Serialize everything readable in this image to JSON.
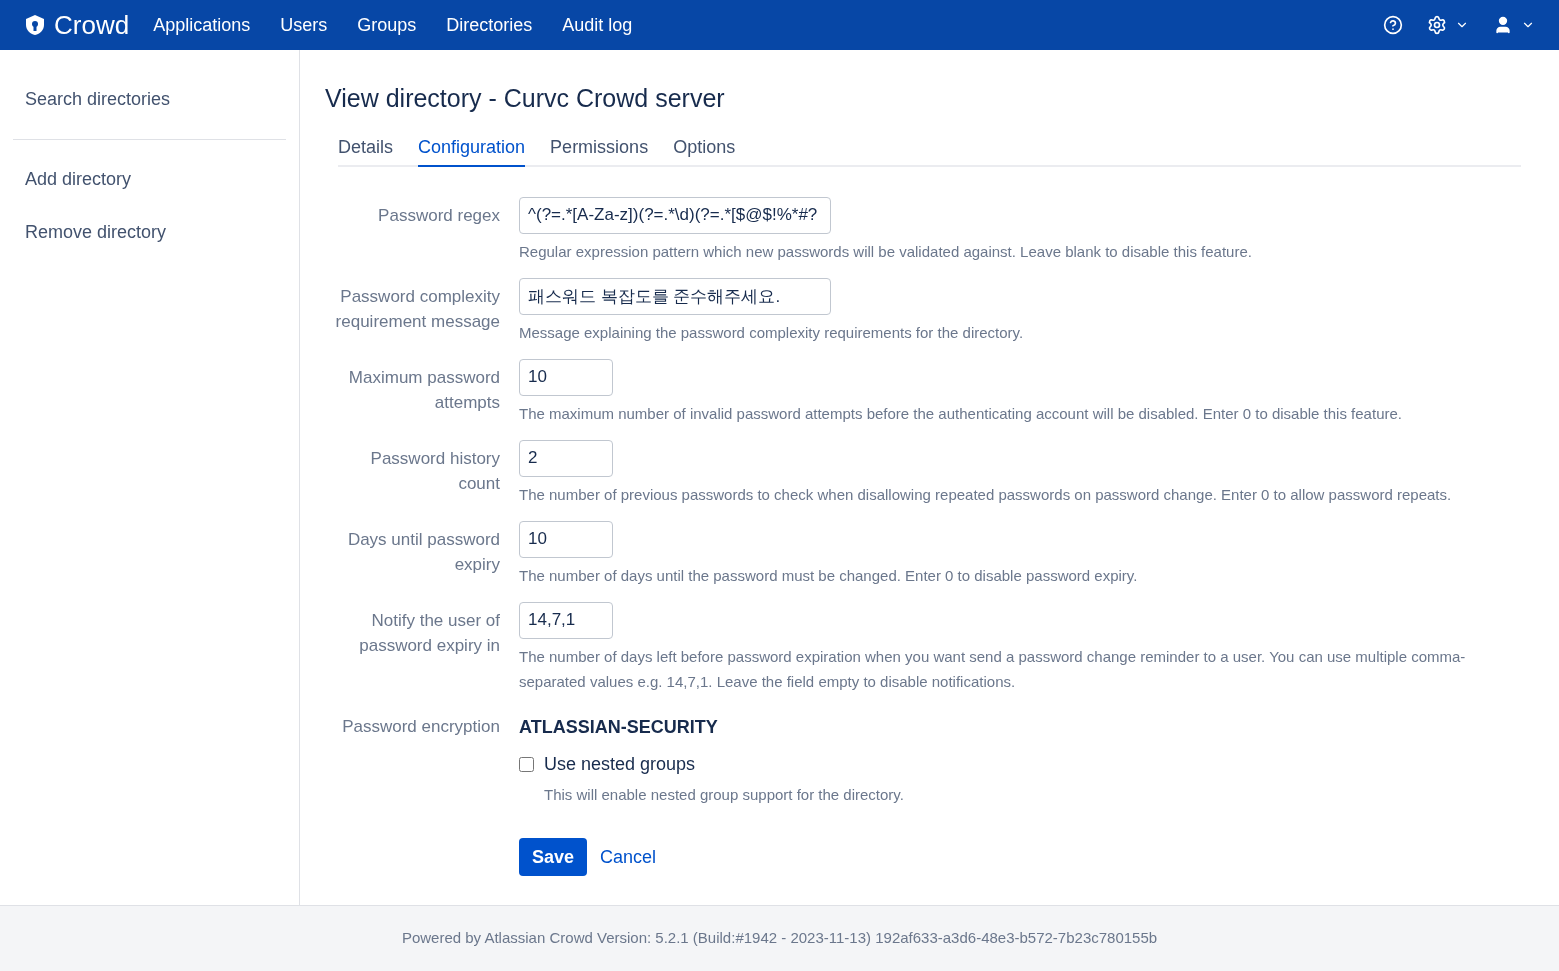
{
  "header": {
    "logo": "Crowd",
    "nav": [
      "Applications",
      "Users",
      "Groups",
      "Directories",
      "Audit log"
    ]
  },
  "sidebar": {
    "sections": [
      {
        "items": [
          "Search directories"
        ]
      },
      {
        "items": [
          "Add directory",
          "Remove directory"
        ]
      }
    ]
  },
  "page_title": "View directory - Curvc Crowd server",
  "tabs": [
    {
      "label": "Details",
      "selected": false
    },
    {
      "label": "Configuration",
      "selected": true
    },
    {
      "label": "Permissions",
      "selected": false
    },
    {
      "label": "Options",
      "selected": false
    }
  ],
  "fields": [
    {
      "kind": "wide",
      "label": "Password regex",
      "value": "^(?=.*[A-Za-z])(?=.*\\d)(?=.*[$@$!%*#?",
      "help": "Regular expression pattern which new passwords will be validated against. Leave blank to disable this feature."
    },
    {
      "kind": "wide",
      "label": "Password complexity requirement message",
      "value": "패스워드 복잡도를 준수해주세요.",
      "help": "Message explaining the password complexity requirements for the directory."
    },
    {
      "kind": "narrow",
      "label": "Maximum password attempts",
      "value": "10",
      "help": "The maximum number of invalid password attempts before the authenticating account will be disabled. Enter 0 to disable this feature."
    },
    {
      "kind": "narrow",
      "label": "Password history count",
      "value": "2",
      "help": "The number of previous passwords to check when disallowing repeated passwords on password change. Enter 0 to allow password repeats."
    },
    {
      "kind": "narrow",
      "label": "Days until password expiry",
      "value": "10",
      "help": "The number of days until the password must be changed. Enter 0 to disable password expiry."
    },
    {
      "kind": "narrow",
      "label": "Notify the user of password expiry in",
      "value": "14,7,1",
      "help": "The number of days left before password expiration when you want send a password change reminder to a user. You can use multiple comma-separated values e.g. 14,7,1. Leave the field empty to disable notifications."
    },
    {
      "kind": "static",
      "label": "Password encryption",
      "value": "ATLASSIAN-SECURITY"
    }
  ],
  "nested_groups": {
    "label": "Use nested groups",
    "checked": false,
    "help": "This will enable nested group support for the directory."
  },
  "buttons": {
    "save": "Save",
    "cancel": "Cancel"
  },
  "footer": "Powered by Atlassian Crowd Version: 5.2.1 (Build:#1942 - 2023-11-13) 192af633-a3d6-48e3-b572-7b23c780155b"
}
